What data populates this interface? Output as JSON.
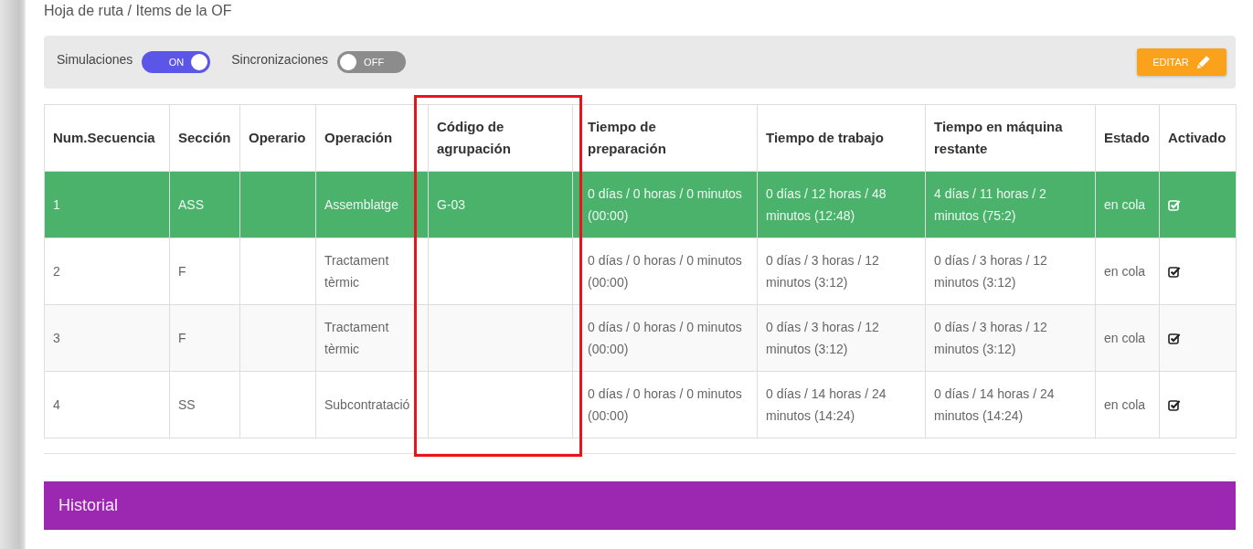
{
  "breadcrumb": "Hoja de ruta / Items de la OF",
  "toolbar": {
    "toggles": [
      {
        "label": "Simulaciones",
        "on": true,
        "text": "ON"
      },
      {
        "label": "Sincronizaciones",
        "on": false,
        "text": "OFF"
      }
    ],
    "edit_button": {
      "label": "EDITAR"
    }
  },
  "table": {
    "columns": [
      "Num.Secuencia",
      "Sección",
      "Operario",
      "Operación",
      "Código de agrupación",
      "Tiempo de preparación",
      "Tiempo de trabajo",
      "Tiempo en máquina restante",
      "Estado",
      "Activado"
    ],
    "rows": [
      {
        "selected": true,
        "num": "1",
        "seccion": "ASS",
        "operacion": "Assemblatge",
        "codigo": "G-03",
        "preparacion": "0 días / 0 horas / 0 minutos (00:00)",
        "trabajo": "0 días / 12 horas / 48 minutos (12:48)",
        "restante": "4 días / 11 horas / 2 minutos (75:2)",
        "estado": "en cola",
        "activado": true
      },
      {
        "selected": false,
        "num": "2",
        "seccion": "F",
        "operacion": "Tractament tèrmic",
        "preparacion": "0 días / 0 horas / 0 minutos (00:00)",
        "trabajo": "0 días / 3 horas / 12 minutos (3:12)",
        "restante": "0 días / 3 horas / 12 minutos (3:12)",
        "estado": "en cola",
        "activado": true
      },
      {
        "selected": false,
        "num": "3",
        "seccion": "F",
        "operacion": "Tractament tèrmic",
        "preparacion": "0 días / 0 horas / 0 minutos (00:00)",
        "trabajo": "0 días / 3 horas / 12 minutos (3:12)",
        "restante": "0 días / 3 horas / 12 minutos (3:12)",
        "estado": "en cola",
        "activado": true
      },
      {
        "selected": false,
        "num": "4",
        "seccion": "SS",
        "operacion": "Subcontratació",
        "preparacion": "0 días / 0 horas / 0 minutos (00:00)",
        "trabajo": "0 días / 14 horas / 24 minutos (14:24)",
        "restante": "0 días / 14 horas / 24 minutos (14:24)",
        "estado": "en cola",
        "activado": true
      }
    ]
  },
  "history": {
    "title": "Historial"
  }
}
